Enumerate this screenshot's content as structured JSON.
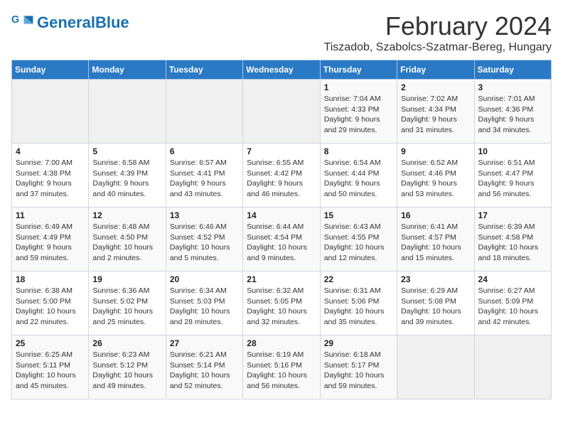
{
  "header": {
    "logo_general": "General",
    "logo_blue": "Blue",
    "month": "February 2024",
    "location": "Tiszadob, Szabolcs-Szatmar-Bereg, Hungary"
  },
  "weekdays": [
    "Sunday",
    "Monday",
    "Tuesday",
    "Wednesday",
    "Thursday",
    "Friday",
    "Saturday"
  ],
  "weeks": [
    [
      {
        "day": "",
        "info": ""
      },
      {
        "day": "",
        "info": ""
      },
      {
        "day": "",
        "info": ""
      },
      {
        "day": "",
        "info": ""
      },
      {
        "day": "1",
        "info": "Sunrise: 7:04 AM\nSunset: 4:33 PM\nDaylight: 9 hours\nand 29 minutes."
      },
      {
        "day": "2",
        "info": "Sunrise: 7:02 AM\nSunset: 4:34 PM\nDaylight: 9 hours\nand 31 minutes."
      },
      {
        "day": "3",
        "info": "Sunrise: 7:01 AM\nSunset: 4:36 PM\nDaylight: 9 hours\nand 34 minutes."
      }
    ],
    [
      {
        "day": "4",
        "info": "Sunrise: 7:00 AM\nSunset: 4:38 PM\nDaylight: 9 hours\nand 37 minutes."
      },
      {
        "day": "5",
        "info": "Sunrise: 6:58 AM\nSunset: 4:39 PM\nDaylight: 9 hours\nand 40 minutes."
      },
      {
        "day": "6",
        "info": "Sunrise: 6:57 AM\nSunset: 4:41 PM\nDaylight: 9 hours\nand 43 minutes."
      },
      {
        "day": "7",
        "info": "Sunrise: 6:55 AM\nSunset: 4:42 PM\nDaylight: 9 hours\nand 46 minutes."
      },
      {
        "day": "8",
        "info": "Sunrise: 6:54 AM\nSunset: 4:44 PM\nDaylight: 9 hours\nand 50 minutes."
      },
      {
        "day": "9",
        "info": "Sunrise: 6:52 AM\nSunset: 4:46 PM\nDaylight: 9 hours\nand 53 minutes."
      },
      {
        "day": "10",
        "info": "Sunrise: 6:51 AM\nSunset: 4:47 PM\nDaylight: 9 hours\nand 56 minutes."
      }
    ],
    [
      {
        "day": "11",
        "info": "Sunrise: 6:49 AM\nSunset: 4:49 PM\nDaylight: 9 hours\nand 59 minutes."
      },
      {
        "day": "12",
        "info": "Sunrise: 6:48 AM\nSunset: 4:50 PM\nDaylight: 10 hours\nand 2 minutes."
      },
      {
        "day": "13",
        "info": "Sunrise: 6:46 AM\nSunset: 4:52 PM\nDaylight: 10 hours\nand 5 minutes."
      },
      {
        "day": "14",
        "info": "Sunrise: 6:44 AM\nSunset: 4:54 PM\nDaylight: 10 hours\nand 9 minutes."
      },
      {
        "day": "15",
        "info": "Sunrise: 6:43 AM\nSunset: 4:55 PM\nDaylight: 10 hours\nand 12 minutes."
      },
      {
        "day": "16",
        "info": "Sunrise: 6:41 AM\nSunset: 4:57 PM\nDaylight: 10 hours\nand 15 minutes."
      },
      {
        "day": "17",
        "info": "Sunrise: 6:39 AM\nSunset: 4:58 PM\nDaylight: 10 hours\nand 18 minutes."
      }
    ],
    [
      {
        "day": "18",
        "info": "Sunrise: 6:38 AM\nSunset: 5:00 PM\nDaylight: 10 hours\nand 22 minutes."
      },
      {
        "day": "19",
        "info": "Sunrise: 6:36 AM\nSunset: 5:02 PM\nDaylight: 10 hours\nand 25 minutes."
      },
      {
        "day": "20",
        "info": "Sunrise: 6:34 AM\nSunset: 5:03 PM\nDaylight: 10 hours\nand 28 minutes."
      },
      {
        "day": "21",
        "info": "Sunrise: 6:32 AM\nSunset: 5:05 PM\nDaylight: 10 hours\nand 32 minutes."
      },
      {
        "day": "22",
        "info": "Sunrise: 6:31 AM\nSunset: 5:06 PM\nDaylight: 10 hours\nand 35 minutes."
      },
      {
        "day": "23",
        "info": "Sunrise: 6:29 AM\nSunset: 5:08 PM\nDaylight: 10 hours\nand 39 minutes."
      },
      {
        "day": "24",
        "info": "Sunrise: 6:27 AM\nSunset: 5:09 PM\nDaylight: 10 hours\nand 42 minutes."
      }
    ],
    [
      {
        "day": "25",
        "info": "Sunrise: 6:25 AM\nSunset: 5:11 PM\nDaylight: 10 hours\nand 45 minutes."
      },
      {
        "day": "26",
        "info": "Sunrise: 6:23 AM\nSunset: 5:12 PM\nDaylight: 10 hours\nand 49 minutes."
      },
      {
        "day": "27",
        "info": "Sunrise: 6:21 AM\nSunset: 5:14 PM\nDaylight: 10 hours\nand 52 minutes."
      },
      {
        "day": "28",
        "info": "Sunrise: 6:19 AM\nSunset: 5:16 PM\nDaylight: 10 hours\nand 56 minutes."
      },
      {
        "day": "29",
        "info": "Sunrise: 6:18 AM\nSunset: 5:17 PM\nDaylight: 10 hours\nand 59 minutes."
      },
      {
        "day": "",
        "info": ""
      },
      {
        "day": "",
        "info": ""
      }
    ]
  ]
}
